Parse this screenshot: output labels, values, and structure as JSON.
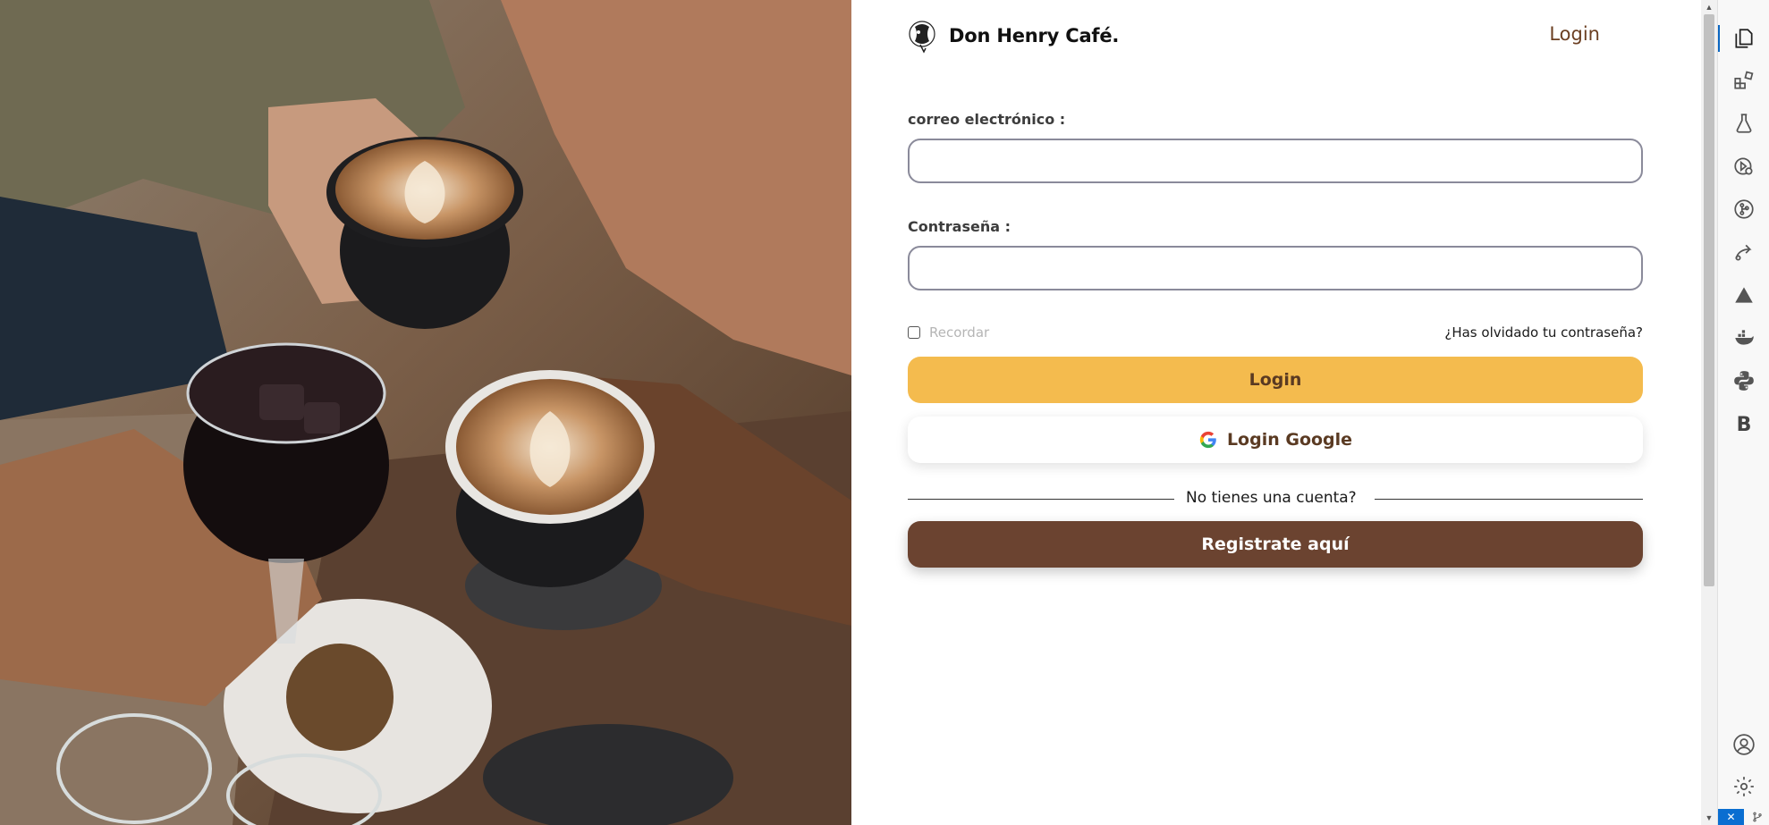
{
  "hero": {
    "alt": "Friends toasting with coffee cups and a glass of iced coffee"
  },
  "header": {
    "brand_name": "Don Henry Café.",
    "nav_login": "Login"
  },
  "form": {
    "email_label": "correo electrónico :",
    "email_value": "",
    "password_label": "Contraseña :",
    "password_value": "",
    "remember_label": "Recordar",
    "remember_checked": false,
    "forgot_link": "¿Has olvidado tu contraseña?",
    "login_button": "Login",
    "google_button": "Login Google",
    "divider_text": "No tienes una cuenta?",
    "register_button": "Registrate aquí"
  },
  "colors": {
    "login_button": "#f4bb4e",
    "register_button": "#6b4330",
    "brand_text": "#6b3f22"
  },
  "activity_bar": {
    "items": [
      "explorer-icon",
      "extensions-icon",
      "testing-icon",
      "run-debug-icon",
      "source-control-icon",
      "remote-explorer-icon",
      "azure-icon",
      "docker-icon",
      "python-icon",
      "bootstrap-icon"
    ],
    "bootstrap_letter": "B",
    "bottom": [
      "account-icon",
      "settings-icon"
    ]
  }
}
